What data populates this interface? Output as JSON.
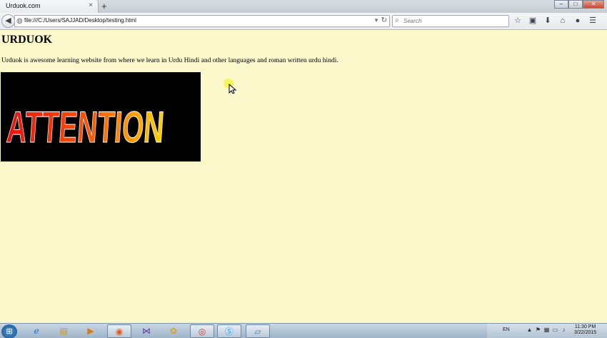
{
  "browser": {
    "tab_title": "Urduok.com",
    "tab_close": "×",
    "new_tab": "+",
    "window_controls": {
      "minimize": "–",
      "maximize": "□",
      "close": "✕"
    },
    "url": "file:///C:/Users/SAJJAD/Desktop/testing.html",
    "search_placeholder": "Search"
  },
  "page": {
    "heading": "URDUOK",
    "paragraph": "Urduok is awesome learning website from where we learn in Urdu Hindi and other languages and roman written urdu hindi.",
    "banner_text": "ATTENTION"
  },
  "icons": {
    "toolbar": [
      "star-icon",
      "bookmarks-icon",
      "download-icon",
      "home-icon",
      "chat-icon",
      "menu-icon"
    ],
    "taskbar": [
      "start-icon",
      "ie-icon",
      "explorer-icon",
      "media-icon",
      "firefox-icon",
      "vs-icon",
      "paint-icon",
      "chrome-icon",
      "skype-icon",
      "notepad-icon"
    ]
  },
  "taskbar": {
    "language": "EN",
    "time": "11:30 PM",
    "date": "3/22/2015"
  },
  "colors": {
    "page_background": "#fbf8cc",
    "attention_red": "#e81010",
    "attention_yellow": "#ffd400"
  }
}
